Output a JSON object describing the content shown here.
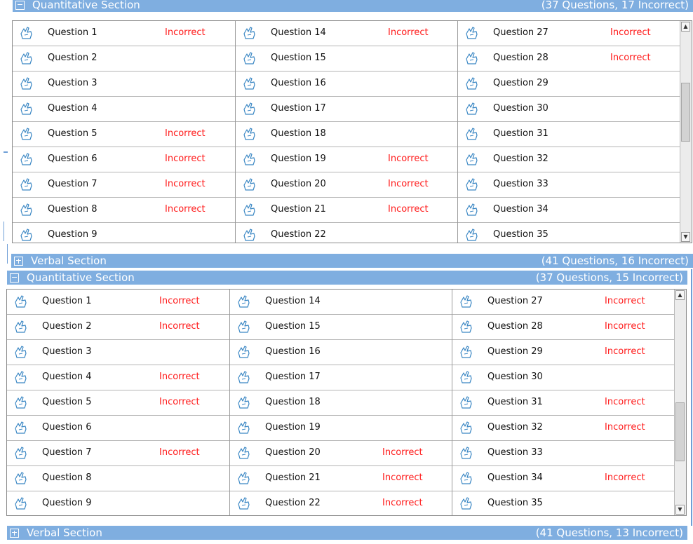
{
  "panels": [
    {
      "quant_title": "Quantitative Section",
      "quant_summary": "(37 Questions, 17 Incorrect)",
      "verbal_title": "Verbal Section",
      "verbal_summary": "(41 Questions, 16 Incorrect)",
      "scroll_thumb_fraction": 0.36,
      "columns": [
        [
          {
            "label": "Question 1",
            "status": "Incorrect"
          },
          {
            "label": "Question 2",
            "status": ""
          },
          {
            "label": "Question 3",
            "status": ""
          },
          {
            "label": "Question 4",
            "status": ""
          },
          {
            "label": "Question 5",
            "status": "Incorrect"
          },
          {
            "label": "Question 6",
            "status": "Incorrect"
          },
          {
            "label": "Question 7",
            "status": "Incorrect"
          },
          {
            "label": "Question 8",
            "status": "Incorrect"
          },
          {
            "label": "Question 9",
            "status": ""
          }
        ],
        [
          {
            "label": "Question 14",
            "status": "Incorrect"
          },
          {
            "label": "Question 15",
            "status": ""
          },
          {
            "label": "Question 16",
            "status": ""
          },
          {
            "label": "Question 17",
            "status": ""
          },
          {
            "label": "Question 18",
            "status": ""
          },
          {
            "label": "Question 19",
            "status": "Incorrect"
          },
          {
            "label": "Question 20",
            "status": "Incorrect"
          },
          {
            "label": "Question 21",
            "status": "Incorrect"
          },
          {
            "label": "Question 22",
            "status": ""
          }
        ],
        [
          {
            "label": "Question 27",
            "status": "Incorrect"
          },
          {
            "label": "Question 28",
            "status": "Incorrect"
          },
          {
            "label": "Question 29",
            "status": ""
          },
          {
            "label": "Question 30",
            "status": ""
          },
          {
            "label": "Question 31",
            "status": ""
          },
          {
            "label": "Question 32",
            "status": ""
          },
          {
            "label": "Question 33",
            "status": ""
          },
          {
            "label": "Question 34",
            "status": ""
          },
          {
            "label": "Question 35",
            "status": ""
          }
        ]
      ]
    },
    {
      "quant_title": "Quantitative Section",
      "quant_summary": "(37 Questions, 15 Incorrect)",
      "verbal_title": "Verbal Section",
      "verbal_summary": "(41 Questions, 13 Incorrect)",
      "scroll_thumb_fraction": 0.7,
      "columns": [
        [
          {
            "label": "Question 1",
            "status": "Incorrect"
          },
          {
            "label": "Question 2",
            "status": "Incorrect"
          },
          {
            "label": "Question 3",
            "status": ""
          },
          {
            "label": "Question 4",
            "status": "Incorrect"
          },
          {
            "label": "Question 5",
            "status": "Incorrect"
          },
          {
            "label": "Question 6",
            "status": ""
          },
          {
            "label": "Question 7",
            "status": "Incorrect"
          },
          {
            "label": "Question 8",
            "status": ""
          },
          {
            "label": "Question 9",
            "status": ""
          }
        ],
        [
          {
            "label": "Question 14",
            "status": ""
          },
          {
            "label": "Question 15",
            "status": ""
          },
          {
            "label": "Question 16",
            "status": ""
          },
          {
            "label": "Question 17",
            "status": ""
          },
          {
            "label": "Question 18",
            "status": ""
          },
          {
            "label": "Question 19",
            "status": ""
          },
          {
            "label": "Question 20",
            "status": "Incorrect"
          },
          {
            "label": "Question 21",
            "status": "Incorrect"
          },
          {
            "label": "Question 22",
            "status": "Incorrect"
          }
        ],
        [
          {
            "label": "Question 27",
            "status": "Incorrect"
          },
          {
            "label": "Question 28",
            "status": "Incorrect"
          },
          {
            "label": "Question 29",
            "status": "Incorrect"
          },
          {
            "label": "Question 30",
            "status": ""
          },
          {
            "label": "Question 31",
            "status": "Incorrect"
          },
          {
            "label": "Question 32",
            "status": "Incorrect"
          },
          {
            "label": "Question 33",
            "status": ""
          },
          {
            "label": "Question 34",
            "status": "Incorrect"
          },
          {
            "label": "Question 35",
            "status": ""
          }
        ]
      ]
    }
  ],
  "icons": {
    "row_icon": "pencil-hand-icon",
    "collapse_icon": "minus-box-icon",
    "expand_icon": "plus-box-icon",
    "scroll_up_icon": "up-arrow-icon",
    "scroll_down_icon": "down-arrow-icon"
  },
  "colors": {
    "header_bg": "#7faee0",
    "header_text": "#ffffff",
    "incorrect_text": "#ff1a1a",
    "icon_stroke": "#3a87c4"
  }
}
